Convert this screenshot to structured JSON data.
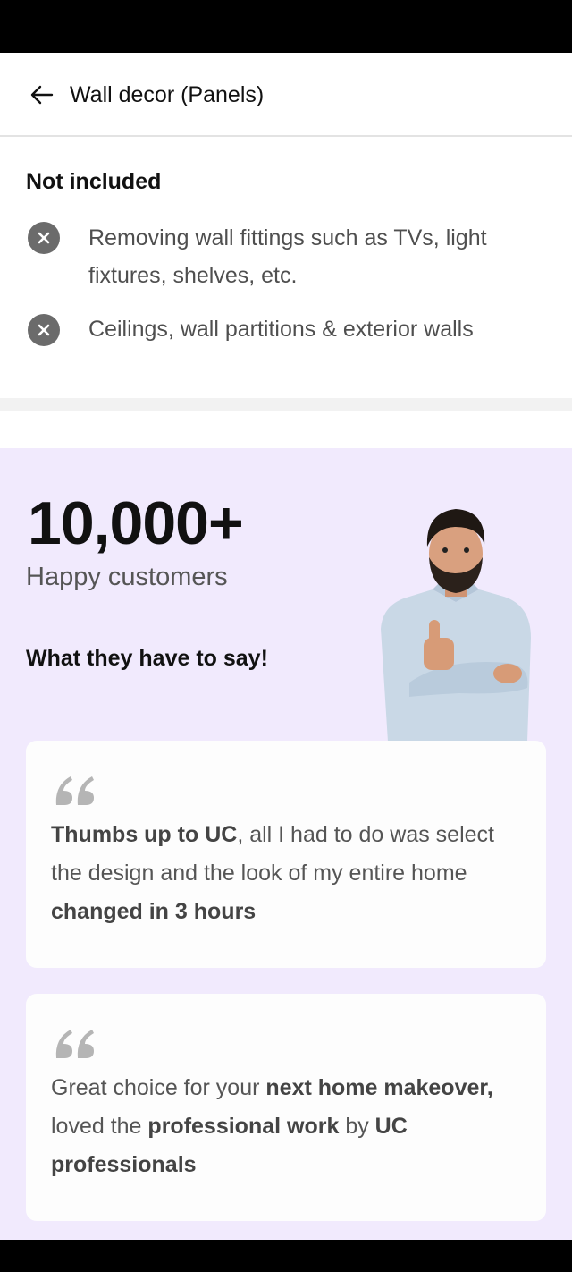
{
  "header": {
    "title": "Wall decor (Panels)"
  },
  "not_included": {
    "title": "Not included",
    "items": [
      {
        "text": "Removing wall fittings such as TVs, light fixtures, shelves, etc."
      },
      {
        "text": "Ceilings, wall partitions & exterior walls"
      }
    ]
  },
  "customers": {
    "count": "10,000+",
    "label": "Happy customers",
    "heading": "What they have to say!",
    "testimonials": [
      {
        "parts": [
          {
            "b": true,
            "t": "Thumbs up to UC"
          },
          {
            "b": false,
            "t": ", all I had to do was select the design and the look of my entire home "
          },
          {
            "b": true,
            "t": "changed in 3 hours"
          }
        ]
      },
      {
        "parts": [
          {
            "b": false,
            "t": "Great choice for your "
          },
          {
            "b": true,
            "t": "next home makeover,"
          },
          {
            "b": false,
            "t": " loved the "
          },
          {
            "b": true,
            "t": "professional work"
          },
          {
            "b": false,
            "t": " by "
          },
          {
            "b": true,
            "t": "UC professionals"
          }
        ]
      }
    ]
  },
  "colors": {
    "accent_bg": "#f1eafd",
    "icon_grey": "#6b6b6b",
    "quote_grey": "#b5b5b5"
  },
  "icons": {
    "back": "arrow-left-icon",
    "excluded": "close-circle-icon",
    "quote": "quote-icon"
  }
}
